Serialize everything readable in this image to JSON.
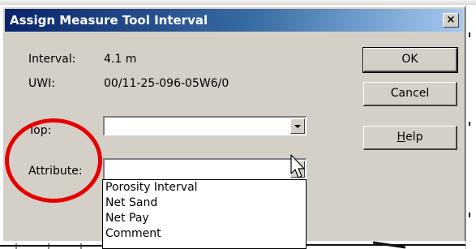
{
  "window": {
    "title": "Assign Measure Tool Interval",
    "close_symbol": "×"
  },
  "info": {
    "interval_label": "Interval:",
    "interval_value": "4.1 m",
    "uwi_label": "UWI:",
    "uwi_value": "00/11-25-096-05W6/0"
  },
  "fields": {
    "top_label": "Top:",
    "top_value": "",
    "attribute_label": "Attribute:",
    "attribute_value": ""
  },
  "dropdown_options": [
    "Porosity Interval",
    "Net Sand",
    "Net Pay",
    "Comment"
  ],
  "buttons": {
    "ok": "OK",
    "cancel": "Cancel",
    "help_prefix": "H",
    "help_rest": "elp"
  },
  "icons": {
    "cursor": "mouse-pointer-icon",
    "dropdown_arrow": "chevron-down-icon"
  },
  "colors": {
    "title_bar_start": "#0a246a",
    "title_bar_end": "#a6caf0",
    "dialog_background": "#d4d0c8",
    "highlight_circle": "#e60000"
  }
}
